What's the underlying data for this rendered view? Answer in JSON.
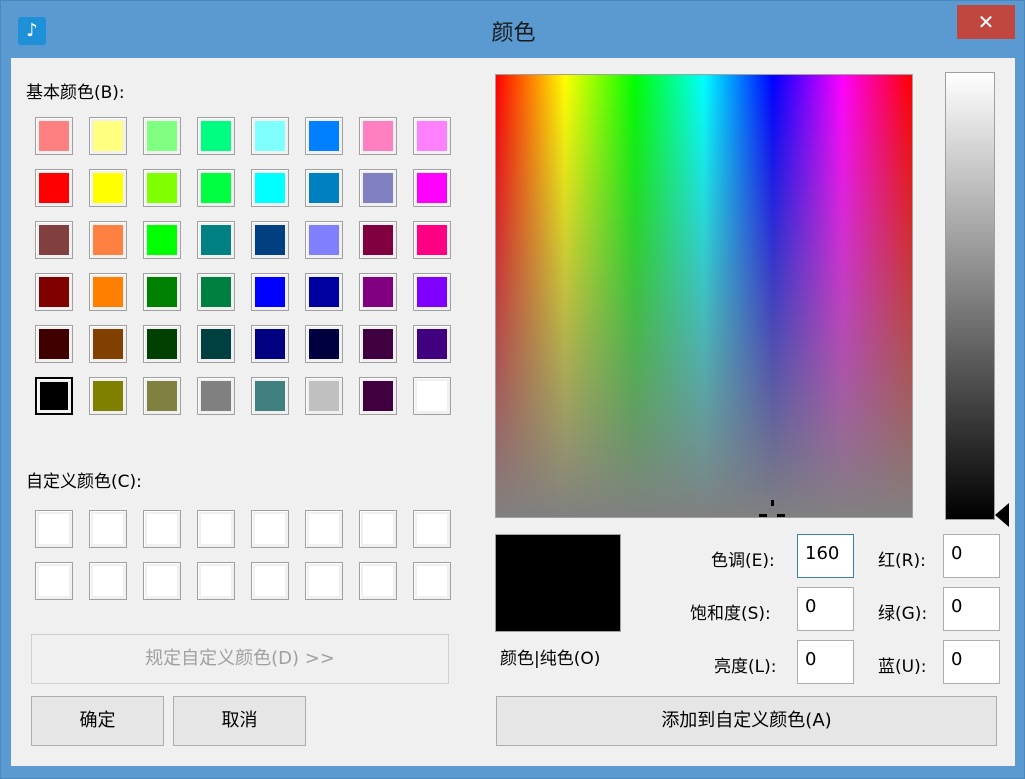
{
  "window": {
    "title": "颜色",
    "close_glyph": "✕",
    "app_icon": "music-note-icon"
  },
  "basic": {
    "label": "基本颜色(B):",
    "rows": [
      [
        "#ff8080",
        "#ffff80",
        "#80ff80",
        "#00ff80",
        "#80ffff",
        "#0080ff",
        "#ff80c0",
        "#ff80ff"
      ],
      [
        "#ff0000",
        "#ffff00",
        "#80ff00",
        "#00ff40",
        "#00ffff",
        "#0080c0",
        "#8080c0",
        "#ff00ff"
      ],
      [
        "#804040",
        "#ff8040",
        "#00ff00",
        "#008080",
        "#004080",
        "#8080ff",
        "#800040",
        "#ff0080"
      ],
      [
        "#800000",
        "#ff8000",
        "#008000",
        "#008040",
        "#0000ff",
        "#0000a0",
        "#800080",
        "#8000ff"
      ],
      [
        "#400000",
        "#804000",
        "#004000",
        "#004040",
        "#000080",
        "#000040",
        "#400040",
        "#400080"
      ],
      [
        "#000000",
        "#808000",
        "#808040",
        "#808080",
        "#408080",
        "#c0c0c0",
        "#400040",
        "#ffffff"
      ]
    ]
  },
  "custom": {
    "label": "自定义颜色(C):",
    "rows": [
      [
        "#ffffff",
        "#ffffff",
        "#ffffff",
        "#ffffff",
        "#ffffff",
        "#ffffff",
        "#ffffff",
        "#ffffff"
      ],
      [
        "#ffffff",
        "#ffffff",
        "#ffffff",
        "#ffffff",
        "#ffffff",
        "#ffffff",
        "#ffffff",
        "#ffffff"
      ]
    ]
  },
  "buttons": {
    "define_custom": "规定自定义颜色(D) >>",
    "ok": "确定",
    "cancel": "取消",
    "add_custom": "添加到自定义颜色(A)"
  },
  "preview_label": "颜色|纯色(O)",
  "fields": {
    "hue_label": "色调(E):",
    "hue": "160",
    "sat_label": "饱和度(S):",
    "sat": "0",
    "lum_label": "亮度(L):",
    "lum": "0",
    "red_label": "红(R):",
    "red": "0",
    "green_label": "绿(G):",
    "green": "0",
    "blue_label": "蓝(U):",
    "blue": "0"
  }
}
